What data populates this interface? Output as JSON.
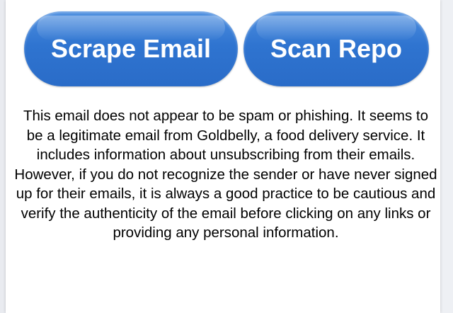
{
  "actions": {
    "scrape_label": "Scrape Email",
    "scan_label": "Scan Repo"
  },
  "result": {
    "text": "This email does not appear to be spam or phishing. It seems to be a legitimate email from Goldbelly, a food delivery service. It includes information about unsubscribing from their emails. However, if you do not recognize the sender or have never signed up for their emails, it is always a good practice to be cautious and verify the authenticity of the email before clicking on any links or providing any personal information."
  },
  "colors": {
    "button_blue": "#2f74d0",
    "button_text": "#ffffff",
    "background": "#ffffff",
    "text": "#000000"
  }
}
